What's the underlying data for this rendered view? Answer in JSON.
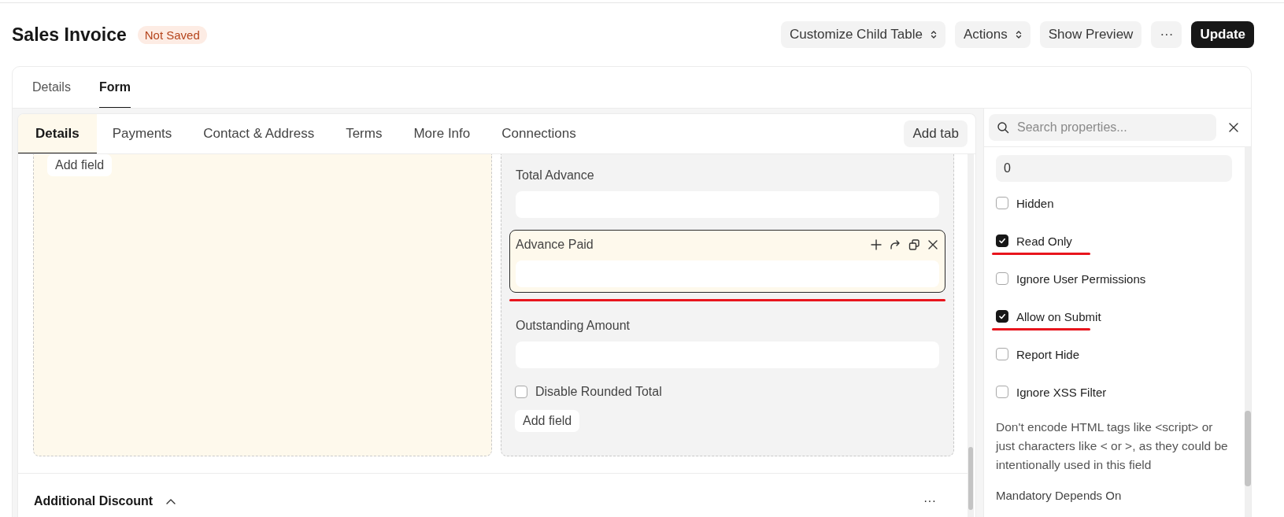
{
  "page": {
    "title": "Sales Invoice",
    "status": "Not Saved"
  },
  "actions": [
    {
      "label": "Customize Child Table",
      "kind": "dropdown"
    },
    {
      "label": "Actions",
      "kind": "dropdown"
    },
    {
      "label": "Show Preview",
      "kind": "plain"
    },
    {
      "label": "···",
      "kind": "plain"
    },
    {
      "label": "Update",
      "kind": "primary"
    }
  ],
  "view_tabs": [
    {
      "label": "Details",
      "selected": false
    },
    {
      "label": "Form",
      "selected": true
    }
  ],
  "form_tabs": [
    {
      "label": "Details",
      "selected": true
    },
    {
      "label": "Payments",
      "selected": false
    },
    {
      "label": "Contact & Address",
      "selected": false
    },
    {
      "label": "Terms",
      "selected": false
    },
    {
      "label": "More Info",
      "selected": false
    },
    {
      "label": "Connections",
      "selected": false
    }
  ],
  "add_tab": "Add tab",
  "columns": [
    {
      "add_field": "Add field"
    },
    {
      "fields": [
        {
          "kind": "data",
          "label": "Total Advance",
          "selected": false,
          "underlined": false
        },
        {
          "kind": "data",
          "label": "Advance Paid",
          "selected": true,
          "underlined": true
        },
        {
          "kind": "data",
          "label": "Outstanding Amount",
          "selected": false,
          "underlined": false
        },
        {
          "kind": "check",
          "label": "Disable Rounded Total",
          "checked": false
        }
      ],
      "add_field": "Add field"
    }
  ],
  "section": {
    "title": "Additional Discount",
    "expanded": true,
    "menu": "···"
  },
  "properties": {
    "search_placeholder": "Search properties...",
    "value": "0",
    "options": [
      {
        "label": "Hidden",
        "checked": false,
        "underlined": false
      },
      {
        "label": "Read Only",
        "checked": true,
        "underlined": true
      },
      {
        "label": "Ignore User Permissions",
        "checked": false,
        "underlined": false
      },
      {
        "label": "Allow on Submit",
        "checked": true,
        "underlined": true
      },
      {
        "label": "Report Hide",
        "checked": false,
        "underlined": false
      },
      {
        "label": "Ignore XSS Filter",
        "checked": false,
        "underlined": false
      }
    ],
    "description": "Don't encode HTML tags like <script> or just characters like < or >, as they could be intentionally used in this field",
    "next_label": "Mandatory Depends On"
  }
}
